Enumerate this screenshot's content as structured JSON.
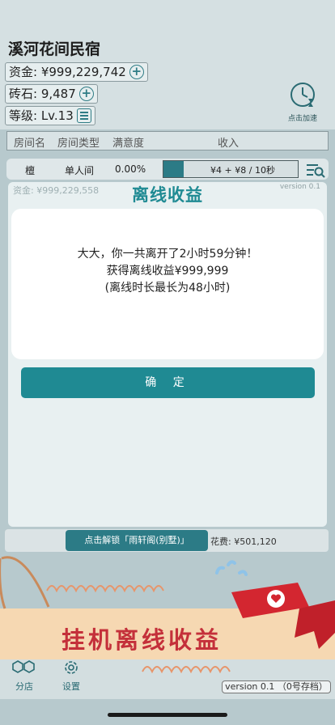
{
  "header": {
    "title": "溪河花间民宿",
    "funds_label": "资金: ¥999,229,742",
    "bricks_label": "砖石: 9,487",
    "level_label": "等级: Lv.13",
    "speed_label": "点击加速"
  },
  "table": {
    "columns": [
      "房间名",
      "房间类型",
      "满意度",
      "收入"
    ],
    "row": {
      "name": "檀",
      "type": "单人间",
      "satisfaction": "0.00%",
      "income": "¥4 + ¥8 / 10秒",
      "progress": 0.15
    }
  },
  "dialog": {
    "funds": "资金: ¥999,229,558",
    "version": "version 0.1",
    "title": "离线收益",
    "line1": "大大，你一共离开了2小时59分钟！",
    "line2": "获得离线收益¥999,999",
    "line3": "(离线时长最长为48小时)",
    "confirm": "确 定"
  },
  "unlock": {
    "button": "点击解锁「雨轩阁(别墅)」",
    "cost": "花费: ¥501,120"
  },
  "banner": {
    "text": "挂机离线收益"
  },
  "tabs": {
    "branch": "分店",
    "settings": "设置"
  },
  "footer": {
    "version": "version 0.1 （0号存档）"
  },
  "colors": {
    "accent": "#1f8a93",
    "accent_dark": "#2c7b86",
    "banner_red": "#c4303a",
    "banner_bg": "#f6d8b2"
  },
  "icons": [
    "plus-icon",
    "list-icon",
    "clock-icon",
    "search-list-icon",
    "heart-icon",
    "branch-icon",
    "gear-icon"
  ]
}
